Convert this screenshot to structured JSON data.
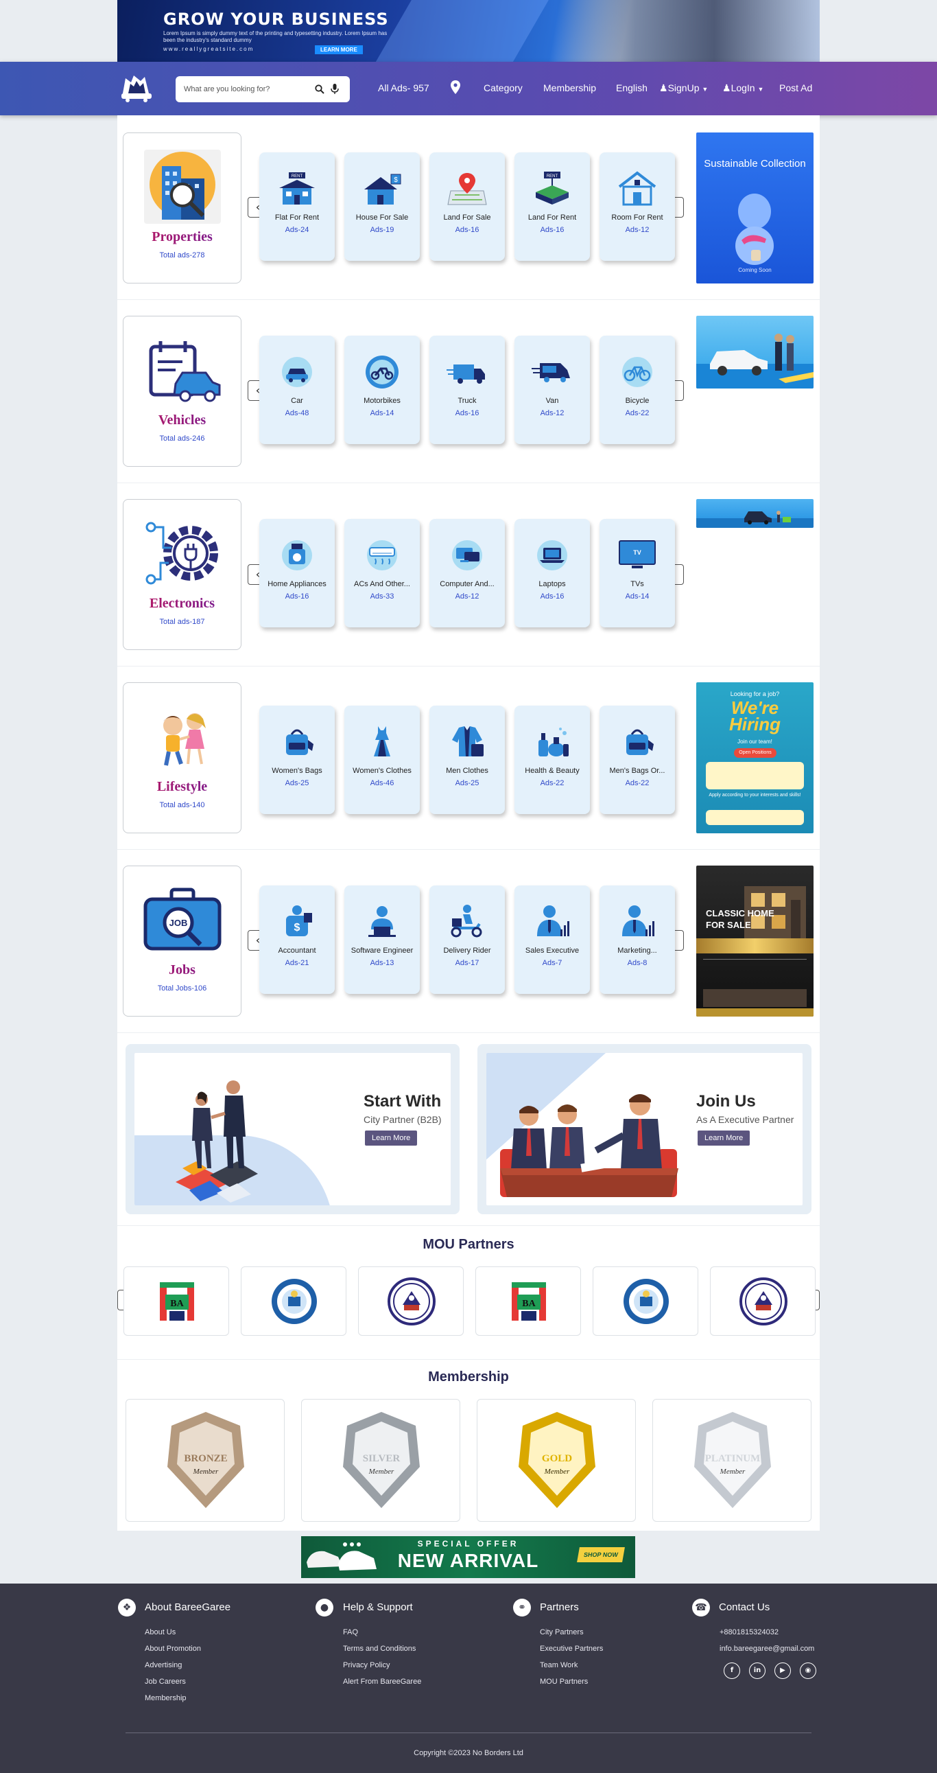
{
  "top_banner": {
    "title": "GROW YOUR BUSINESS",
    "text": "Lorem Ipsum is simply dummy text of the printing and typesetting industry. Lorem Ipsum has been the industry's standard dummy",
    "url": "www.reallygreatsite.com",
    "button": "LEARN MORE"
  },
  "header": {
    "search_placeholder": "What are you looking for?",
    "all_ads": "All Ads- 957",
    "category": "Category",
    "membership": "Membership",
    "language": "English",
    "signup": "SignUp",
    "login": "LogIn",
    "post_ad": "Post Ad"
  },
  "categories": [
    {
      "title": "Properties",
      "total": "Total ads-278",
      "subs": [
        {
          "name": "Flat For Rent",
          "ads": "Ads-24",
          "icon": "flat-rent-icon"
        },
        {
          "name": "House For Sale",
          "ads": "Ads-19",
          "icon": "house-sale-icon"
        },
        {
          "name": "Land For Sale",
          "ads": "Ads-16",
          "icon": "land-sale-icon"
        },
        {
          "name": "Land For Rent",
          "ads": "Ads-16",
          "icon": "land-rent-icon"
        },
        {
          "name": "Room For Rent",
          "ads": "Ads-12",
          "icon": "room-rent-icon"
        }
      ],
      "ad": {
        "brand": "Sustainable Collection",
        "small": "Coming Soon"
      }
    },
    {
      "title": "Vehicles",
      "total": "Total ads-246",
      "subs": [
        {
          "name": "Car",
          "ads": "Ads-48",
          "icon": "car-icon"
        },
        {
          "name": "Motorbikes",
          "ads": "Ads-14",
          "icon": "motorbike-icon"
        },
        {
          "name": "Truck",
          "ads": "Ads-16",
          "icon": "truck-icon"
        },
        {
          "name": "Van",
          "ads": "Ads-12",
          "icon": "van-icon"
        },
        {
          "name": "Bicycle",
          "ads": "Ads-22",
          "icon": "bicycle-icon"
        }
      ]
    },
    {
      "title": "Electronics",
      "total": "Total ads-187",
      "subs": [
        {
          "name": "Home Appliances",
          "ads": "Ads-16",
          "icon": "appliance-icon"
        },
        {
          "name": "ACs And Other...",
          "ads": "Ads-33",
          "icon": "ac-icon"
        },
        {
          "name": "Computer And...",
          "ads": "Ads-12",
          "icon": "computer-icon"
        },
        {
          "name": "Laptops",
          "ads": "Ads-16",
          "icon": "laptop-icon"
        },
        {
          "name": "TVs",
          "ads": "Ads-14",
          "icon": "tv-icon",
          "tv_label": "TV"
        }
      ]
    },
    {
      "title": "Lifestyle",
      "total": "Total ads-140",
      "subs": [
        {
          "name": "Women's Bags",
          "ads": "Ads-25",
          "icon": "bag-icon"
        },
        {
          "name": "Women's Clothes",
          "ads": "Ads-46",
          "icon": "dress-icon"
        },
        {
          "name": "Men Clothes",
          "ads": "Ads-25",
          "icon": "shirt-icon"
        },
        {
          "name": "Health & Beauty",
          "ads": "Ads-22",
          "icon": "beauty-icon"
        },
        {
          "name": "Men's Bags Or...",
          "ads": "Ads-22",
          "icon": "backpack-icon"
        }
      ],
      "ad": {
        "top": "Looking for a job?",
        "big1": "We're",
        "big2": "Hiring",
        "join": "Join our team!",
        "open": "Open Positions",
        "apply": "Apply according to your interests and skills!"
      }
    },
    {
      "title": "Jobs",
      "total": "Total Jobs-106",
      "badge": "JOB",
      "subs": [
        {
          "name": "Accountant",
          "ads": "Ads-21",
          "icon": "accountant-icon"
        },
        {
          "name": "Software Engineer",
          "ads": "Ads-13",
          "icon": "engineer-icon"
        },
        {
          "name": "Delivery Rider",
          "ads": "Ads-17",
          "icon": "rider-icon"
        },
        {
          "name": "Sales Executive",
          "ads": "Ads-7",
          "icon": "sales-icon"
        },
        {
          "name": "Marketing...",
          "ads": "Ads-8",
          "icon": "marketing-icon"
        }
      ],
      "ad": {
        "line1": "CLASSIC HOME",
        "line2": "FOR SALE"
      }
    }
  ],
  "partners": [
    {
      "title": "Start With",
      "sub": "City Partner (B2B)",
      "button": "Learn More"
    },
    {
      "title": "Join Us",
      "sub": "As A Executive Partner",
      "button": "Learn More"
    }
  ],
  "mou": {
    "title": "MOU Partners",
    "logo_text": "BA"
  },
  "membership": {
    "title": "Membership",
    "tiers": [
      {
        "name": "BRONZE",
        "sub": "Member",
        "color": "#b59a7e",
        "light": "#e9dccd"
      },
      {
        "name": "SILVER",
        "sub": "Member",
        "color": "#9aa0a6",
        "light": "#eef0f2"
      },
      {
        "name": "GOLD",
        "sub": "Member",
        "color": "#d9a800",
        "light": "#fff3c2"
      },
      {
        "name": "PLATINUM",
        "sub": "Member",
        "color": "#c4c9d0",
        "light": "#f5f6f8"
      }
    ]
  },
  "offer_banner": {
    "special": "SPECIAL OFFER",
    "arrival": "NEW ARRIVAL",
    "shop": "SHOP NOW"
  },
  "footer": {
    "cols": [
      {
        "title": "About BareeGaree",
        "links": [
          "About Us",
          "About Promotion",
          "Advertising",
          "Job Careers",
          "Membership"
        ]
      },
      {
        "title": "Help & Support",
        "links": [
          "FAQ",
          "Terms and Conditions",
          "Privacy Policy",
          "Alert From BareeGaree"
        ]
      },
      {
        "title": "Partners",
        "links": [
          "City Partners",
          "Executive Partners",
          "Team Work",
          "MOU Partners"
        ]
      },
      {
        "title": "Contact Us",
        "links": [
          "+8801815324032",
          "info.bareegaree@gmail.com"
        ]
      }
    ],
    "copyright": "Copyright ©2023 No Borders Ltd"
  }
}
